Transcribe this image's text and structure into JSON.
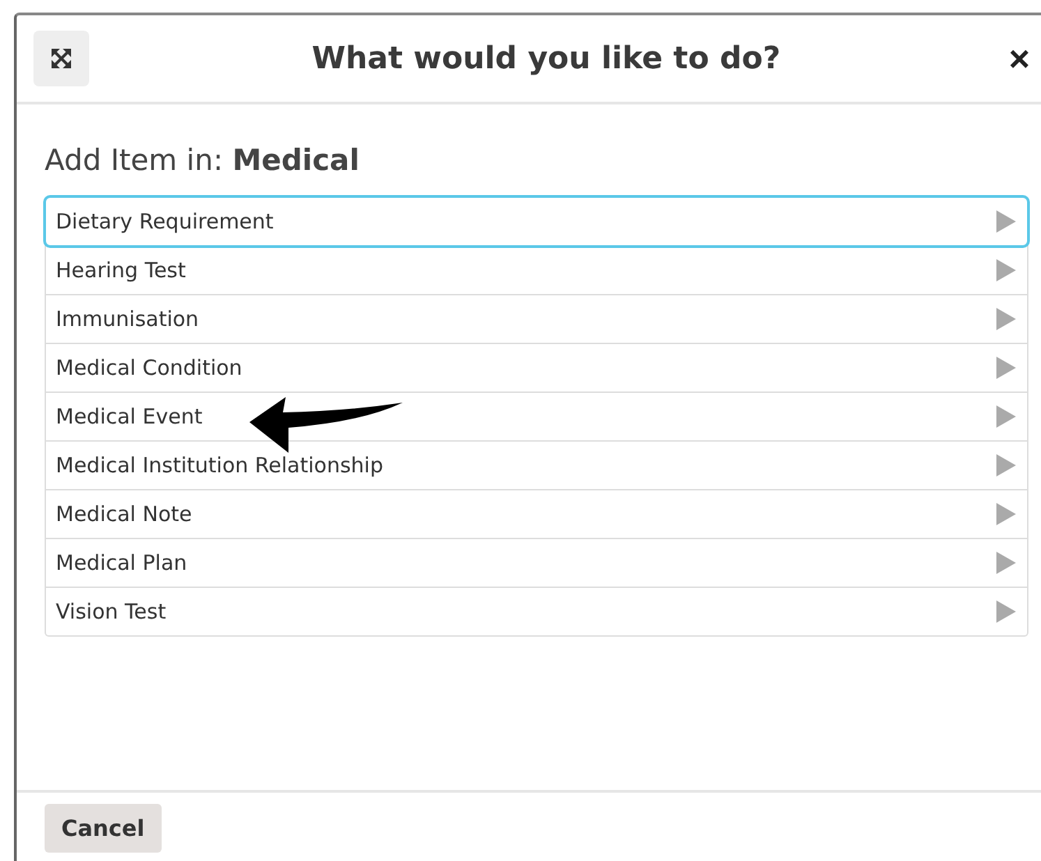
{
  "dialog": {
    "title": "What would you like to do?",
    "close": "×",
    "heading": "Add Item in: **Medical**",
    "items": [
      {
        "label": "Dietary Requirement",
        "selected": true
      },
      {
        "label": "Hearing Test",
        "selected": false
      },
      {
        "label": "Immunisation",
        "selected": false
      },
      {
        "label": "Medical Condition",
        "selected": false
      },
      {
        "label": "Medical Event",
        "selected": false
      },
      {
        "label": "Medical Institution Relationship",
        "selected": false
      },
      {
        "label": "Medical Note",
        "selected": false
      },
      {
        "label": "Medical Plan",
        "selected": false
      },
      {
        "label": "Vision Test",
        "selected": false
      }
    ],
    "buttons": [
      "Cancel"
    ]
  }
}
